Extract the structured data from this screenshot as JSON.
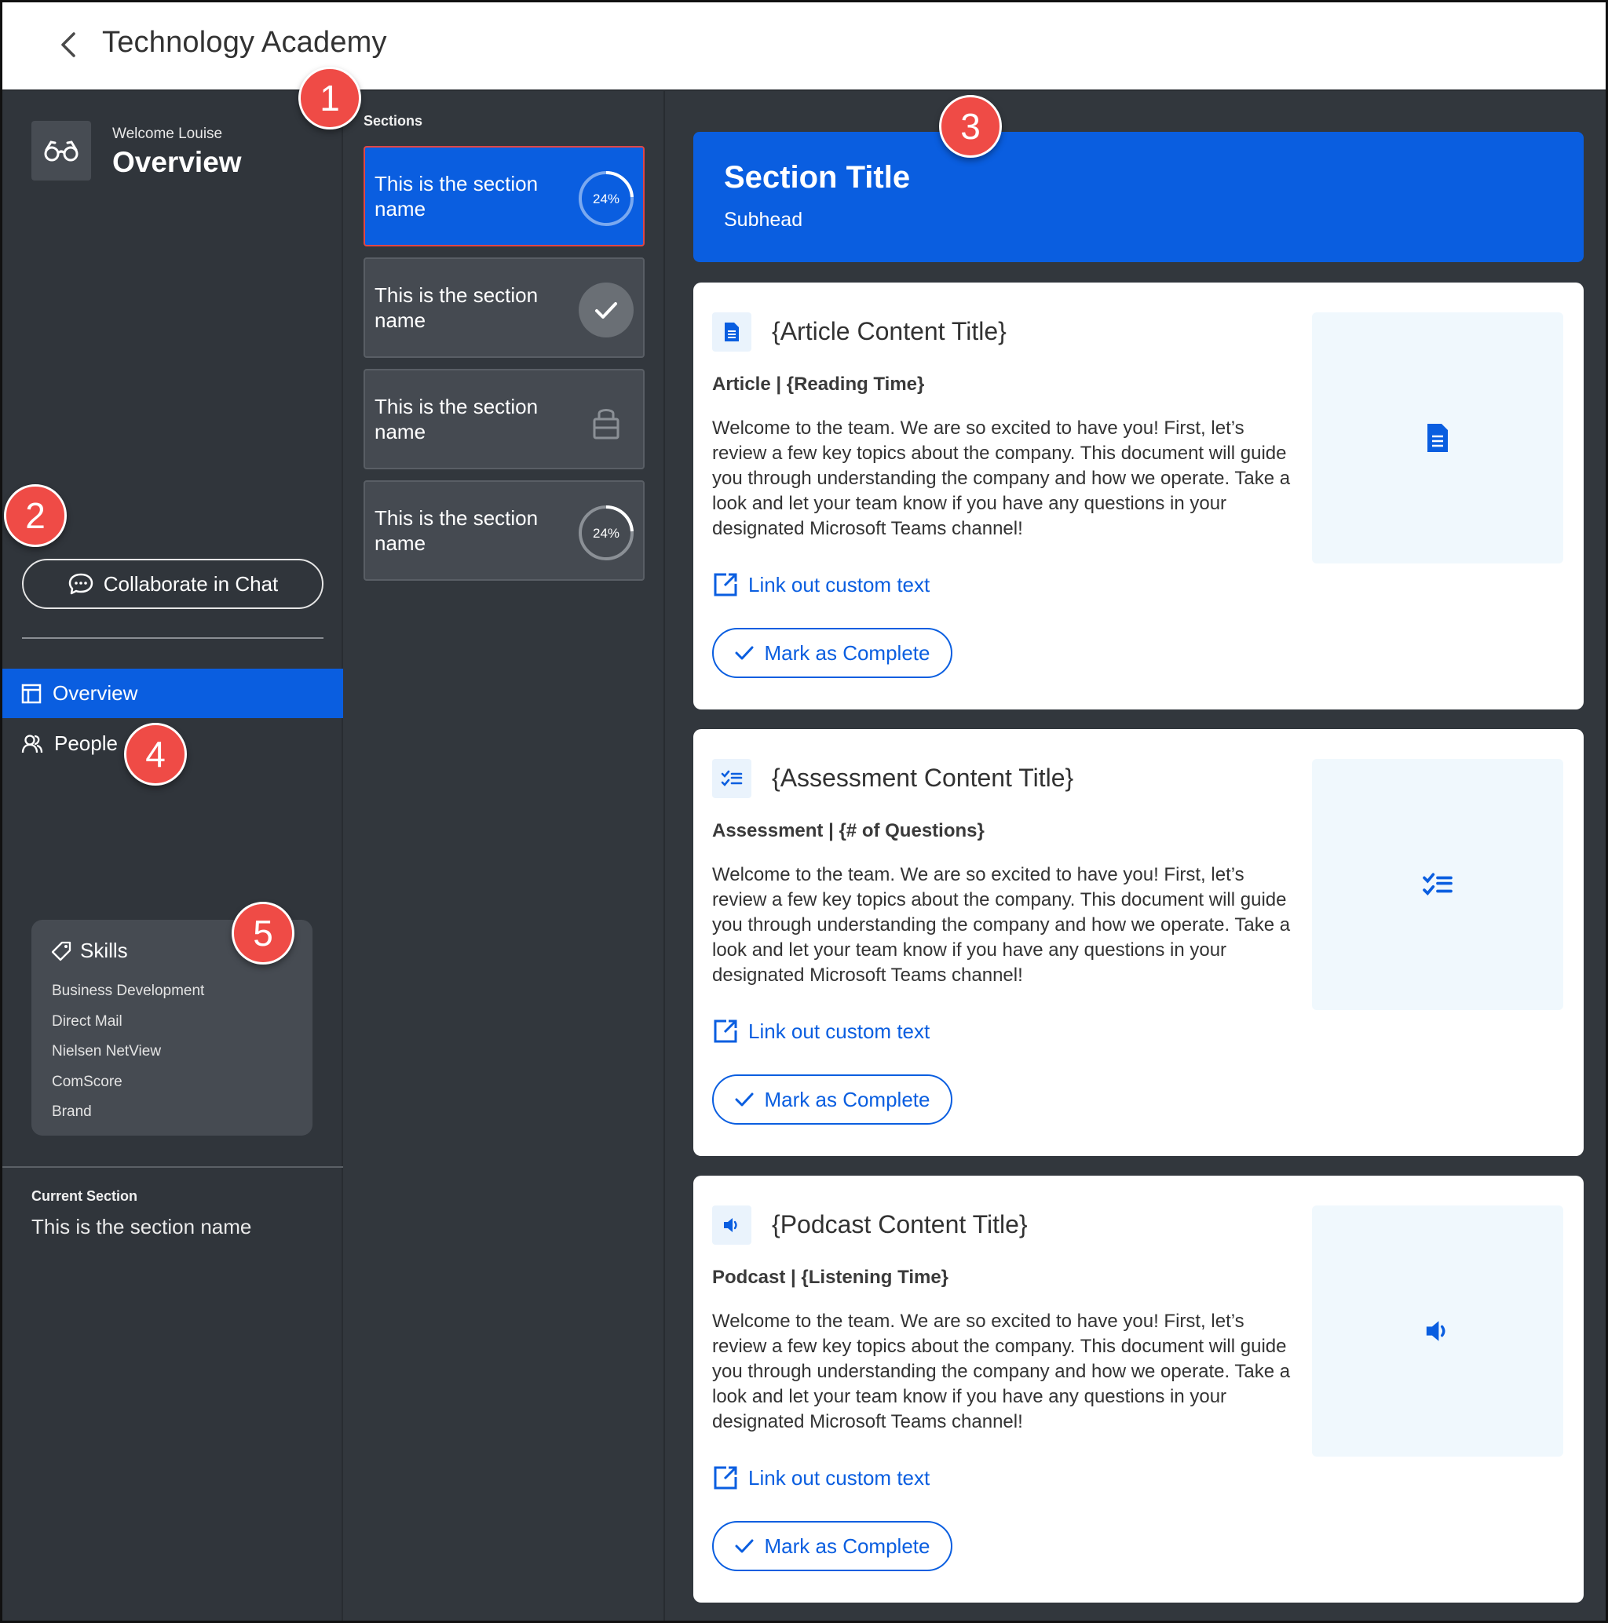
{
  "header": {
    "title": "Technology Academy"
  },
  "sidebar": {
    "welcome": "Welcome Louise",
    "title": "Overview",
    "chat_button": "Collaborate in Chat",
    "nav": [
      {
        "label": "Overview",
        "active": true
      },
      {
        "label": "People",
        "active": false
      }
    ],
    "skills": {
      "title": "Skills",
      "items": [
        "Business Development",
        "Direct Mail",
        "Nielsen NetView",
        "ComScore",
        "Brand"
      ]
    },
    "current_section": {
      "label": "Current Section",
      "value": "This is the section name"
    }
  },
  "sections": {
    "label": "Sections",
    "items": [
      {
        "name": "This is the section name",
        "status": "progress",
        "progress_text": "24%",
        "progress": 0.24,
        "active": true
      },
      {
        "name": "This is the section name",
        "status": "complete"
      },
      {
        "name": "This is the section name",
        "status": "locked"
      },
      {
        "name": "This is the section name",
        "status": "progress",
        "progress_text": "24%",
        "progress": 0.24,
        "active": false
      }
    ]
  },
  "content": {
    "banner": {
      "title": "Section Title",
      "subhead": "Subhead"
    },
    "cards": [
      {
        "icon": "document-icon",
        "title": "{Article Content Title}",
        "meta": "Article | {Reading Time}",
        "body": "Welcome to the team. We are so excited to have you! First, let’s review a few key topics about the company. This document will guide you through understanding the company and how we operate. Take a look and let your team know if you have any questions in your designated Microsoft Teams channel!",
        "link": "Link out custom text",
        "button": "Mark as Complete"
      },
      {
        "icon": "checklist-icon",
        "title": "{Assessment Content Title}",
        "meta": "Assessment | {# of Questions}",
        "body": "Welcome to the team. We are so excited to have you! First, let’s review a few key topics about the company. This document will guide you through understanding the company and how we operate. Take a look and let your team know if you have any questions in your designated Microsoft Teams channel!",
        "link": "Link out custom text",
        "button": "Mark as Complete"
      },
      {
        "icon": "speaker-icon",
        "title": "{Podcast Content Title}",
        "meta": "Podcast | {Listening Time}",
        "body": "Welcome to the team. We are so excited to have you! First, let’s review a few key topics about the company. This document will guide you through understanding the company and how we operate. Take a look and let your team know if you have any questions in your designated Microsoft Teams channel!",
        "link": "Link out custom text",
        "button": "Mark as Complete"
      }
    ]
  },
  "annotations": [
    "1",
    "2",
    "3",
    "4",
    "5"
  ],
  "colors": {
    "accent": "#0a5ee0",
    "dark_bg": "#32373d",
    "badge": "#ef4b46"
  }
}
